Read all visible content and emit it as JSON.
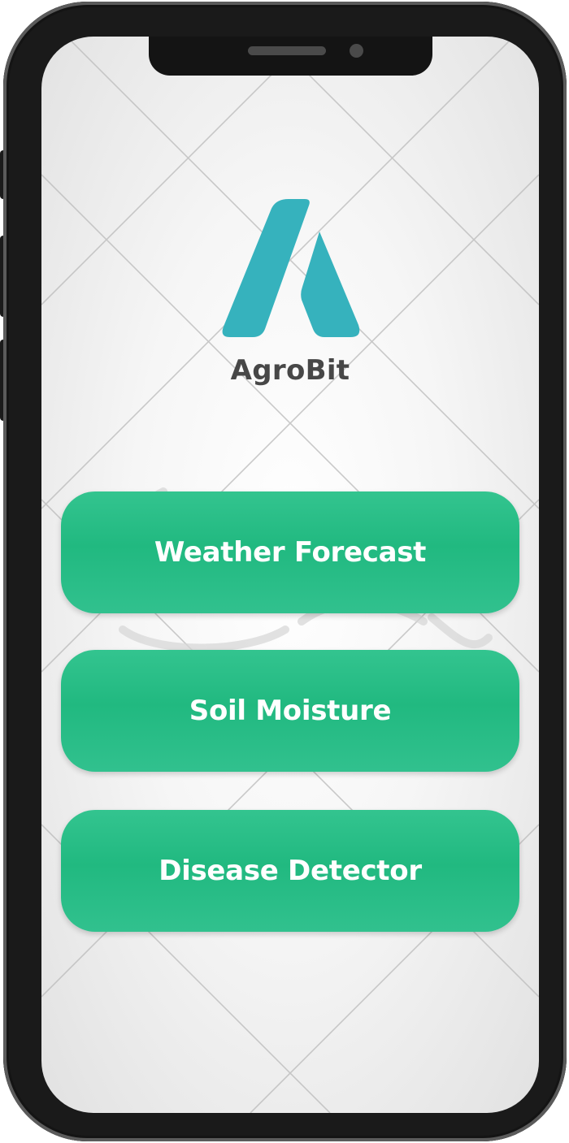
{
  "app": {
    "brand_name": "AgroBit",
    "logo_icon": "agrobit-logo-icon",
    "accent_color": "#36b2bd",
    "button_color": "#25bc84"
  },
  "menu": {
    "items": [
      {
        "label": "Weather Forecast"
      },
      {
        "label": "Soil Moisture"
      },
      {
        "label": "Disease Detector"
      }
    ]
  }
}
